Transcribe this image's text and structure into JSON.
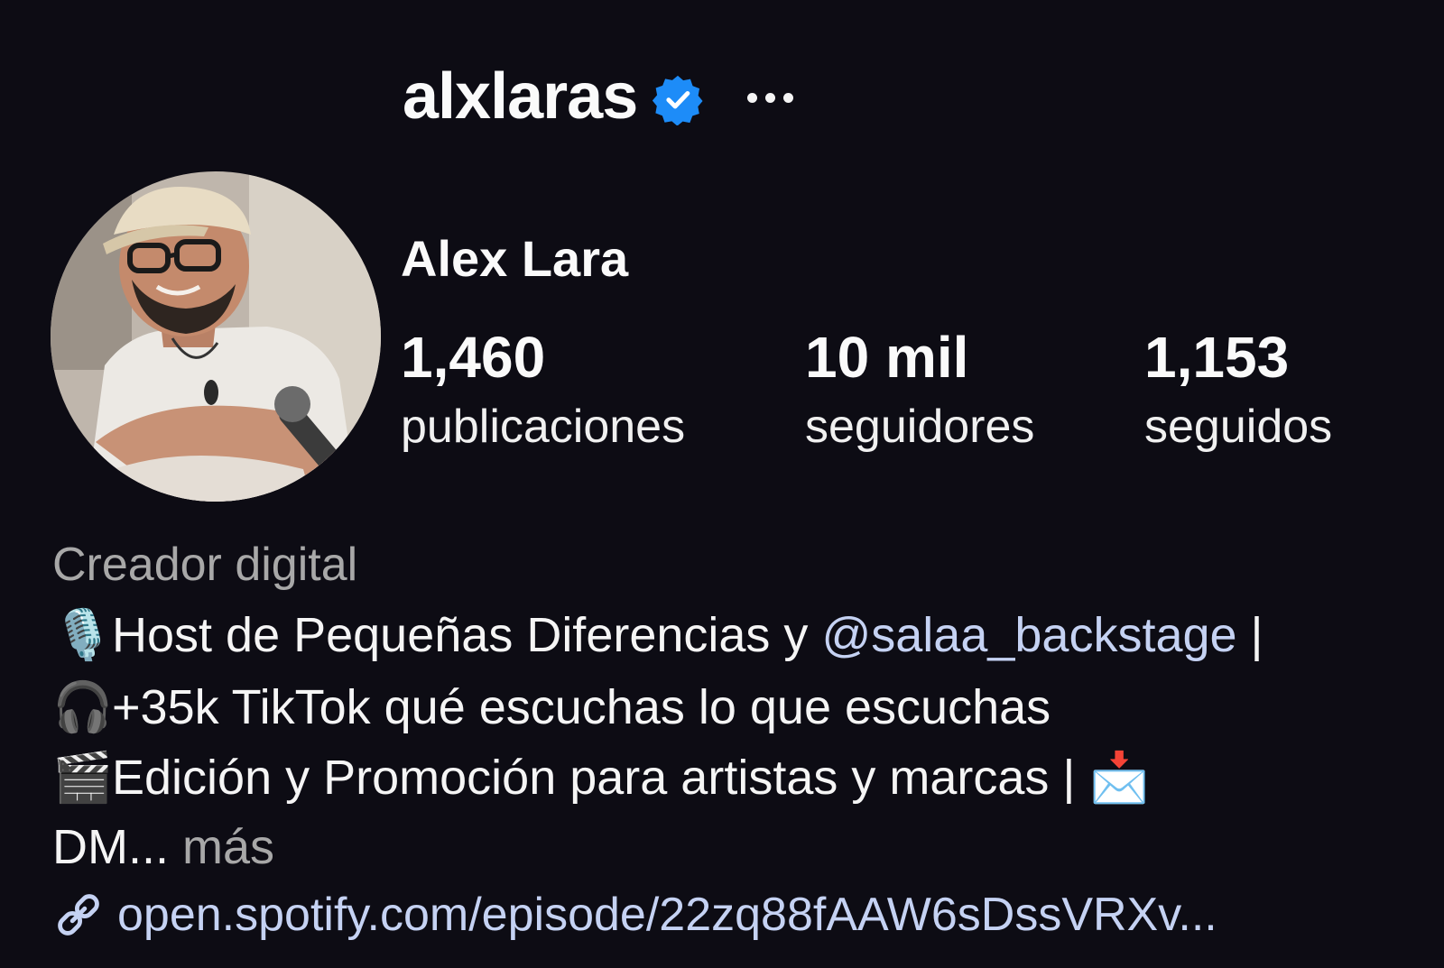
{
  "profile": {
    "username": "alxlaras",
    "verified": true,
    "full_name": "Alex Lara",
    "more_label": "...",
    "stats": {
      "posts": {
        "value": "1,460",
        "label": "publicaciones"
      },
      "followers": {
        "value": "10 mil",
        "label": "seguidores"
      },
      "following": {
        "value": "1,153",
        "label": "seguidos"
      }
    },
    "category": "Creador digital",
    "bio": {
      "line1": {
        "emoji": "🎙️",
        "text": "Host de Pequeñas Diferencias y ",
        "mention": "@salaa_backstage",
        "suffix": " |"
      },
      "line2": {
        "emoji": "🎧",
        "text": "+35k TikTok qué escuchas lo que escuchas"
      },
      "line3": {
        "emoji": "🎬",
        "text": "Edición y Promoción para artistas y marcas | ",
        "emoji_end": "📩"
      },
      "line4": {
        "text": "DM... ",
        "more": "más"
      }
    },
    "link": "open.spotify.com/episode/22zq88fAAW6sDssVRXv..."
  },
  "colors": {
    "background": "#0d0c14",
    "verified_badge": "#1d8cf8",
    "link": "#c5d2f3",
    "secondary_text": "#a8a8a8"
  },
  "icons": {
    "verified": "verified-badge-icon",
    "more": "more-options-icon",
    "link": "link-chain-icon"
  }
}
